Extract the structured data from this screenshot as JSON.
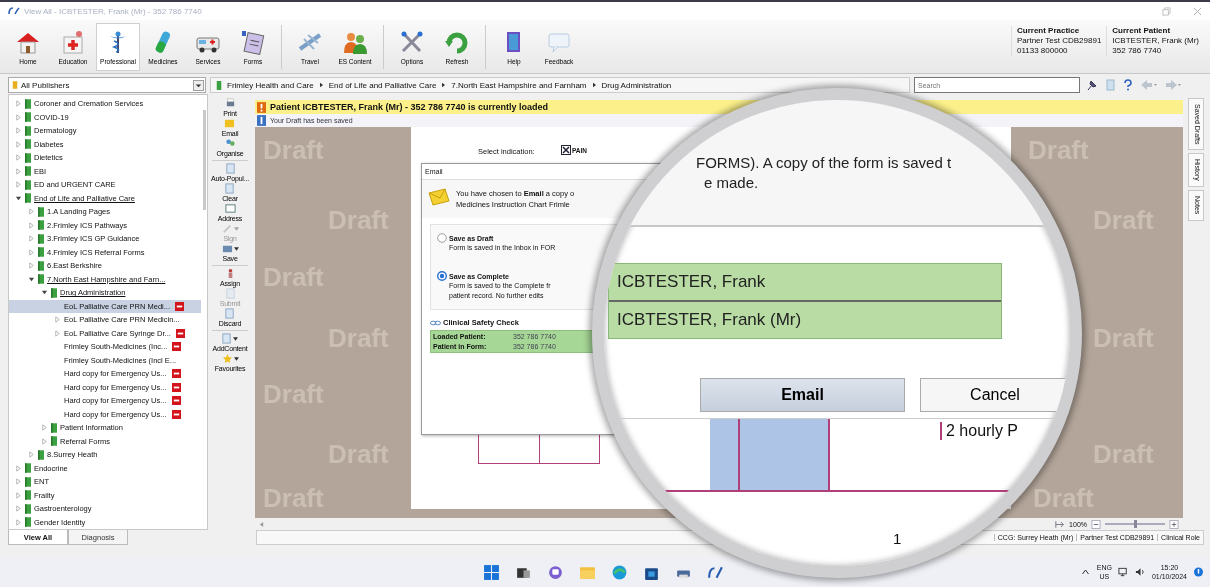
{
  "window": {
    "title": "View All - ICBTESTER, Frank (Mr) - 352 786 7740"
  },
  "toolbar": [
    [
      {
        "label": "Home",
        "kind": "home",
        "selected": false
      },
      {
        "label": "Education",
        "kind": "education",
        "selected": false
      },
      {
        "label": "Professional",
        "kind": "professional",
        "selected": true
      },
      {
        "label": "Medicines",
        "kind": "medicines",
        "selected": false
      },
      {
        "label": "Services",
        "kind": "services",
        "selected": false
      },
      {
        "label": "Forms",
        "kind": "forms",
        "selected": false
      }
    ],
    [
      {
        "label": "Travel",
        "kind": "travel",
        "selected": false
      },
      {
        "label": "ES Content",
        "kind": "content",
        "selected": false
      }
    ],
    [
      {
        "label": "Options",
        "kind": "options",
        "selected": false
      },
      {
        "label": "Refresh",
        "kind": "refresh",
        "selected": false
      }
    ],
    [
      {
        "label": "Help",
        "kind": "help",
        "selected": false
      },
      {
        "label": "Feedback",
        "kind": "feedback",
        "selected": false
      }
    ]
  ],
  "practice": {
    "heading": "Current Practice",
    "name": "Partner Test CDB29891",
    "phone": "01133 800000"
  },
  "patient": {
    "heading": "Current Patient",
    "name": "ICBTESTER, Frank (Mr)",
    "number": "352 786 7740"
  },
  "publisher_select": {
    "value": "All Publishers"
  },
  "breadcrumb": [
    "Frimley Health and Care",
    "End of Life and Palliative Care",
    "7.North East Hampshire and Farnham",
    "Drug Administration"
  ],
  "search": {
    "placeholder": "Search"
  },
  "tree": [
    {
      "label": "Coroner and Cremation Services",
      "expanded": false,
      "selected": false
    },
    {
      "label": "COVID-19",
      "expanded": false,
      "selected": false
    },
    {
      "label": "Dermatology",
      "expanded": false,
      "selected": false
    },
    {
      "label": "Diabetes",
      "expanded": false,
      "selected": false
    },
    {
      "label": "Dietetics",
      "expanded": false,
      "selected": false
    },
    {
      "label": "EBI",
      "expanded": false,
      "selected": false
    },
    {
      "label": "ED and URGENT CARE",
      "expanded": false,
      "selected": false
    },
    {
      "label": "End of Life and Palliative Care",
      "expanded": true,
      "selected": false,
      "children": [
        {
          "label": "1.A Landing Pages",
          "expanded": false,
          "selected": false
        },
        {
          "label": "2.Frimley ICS Pathways",
          "expanded": false,
          "selected": false
        },
        {
          "label": "3.Frimley ICS GP Guidance",
          "expanded": false,
          "selected": false
        },
        {
          "label": "4.Frimley ICS Referral Forms",
          "expanded": false,
          "selected": false
        },
        {
          "label": "6.East Berkshire",
          "expanded": false,
          "selected": false
        },
        {
          "label": "7.North East Hampshire and Farn...",
          "expanded": true,
          "selected": false,
          "children": [
            {
              "label": "Drug Administration",
              "expanded": true,
              "selected": false,
              "children": [
                {
                  "label": "EoL Palliative Care PRN Medi...",
                  "kind": "form",
                  "flagged": true,
                  "selected": true
                },
                {
                  "label": "EoL Palliative Care PRN Medicin...",
                  "kind": "form",
                  "expanded": false,
                  "flagged": false,
                  "selected": false
                },
                {
                  "label": "EoL Palliative Care Syringe Dr...",
                  "kind": "form",
                  "expanded": false,
                  "flagged": true,
                  "selected": false
                },
                {
                  "label": "Frimley South-Medicines (Inc...",
                  "kind": "form",
                  "flagged": true,
                  "selected": false
                },
                {
                  "label": "Frimley South-Medicines (Incl E...",
                  "kind": "form",
                  "flagged": false,
                  "selected": false
                },
                {
                  "label": "Hard copy for Emergency Us...",
                  "kind": "form",
                  "flagged": true,
                  "selected": false
                },
                {
                  "label": "Hard copy for Emergency Us...",
                  "kind": "form",
                  "flagged": true,
                  "selected": false
                },
                {
                  "label": "Hard copy for Emergency Us...",
                  "kind": "form",
                  "flagged": true,
                  "selected": false
                },
                {
                  "label": "Hard copy for Emergency Us...",
                  "kind": "form",
                  "flagged": true,
                  "selected": false
                }
              ]
            },
            {
              "label": "Patient Information",
              "expanded": false,
              "selected": false
            },
            {
              "label": "Referral Forms",
              "expanded": false,
              "selected": false
            }
          ]
        },
        {
          "label": "8.Surrey Heath",
          "expanded": false,
          "selected": false
        }
      ]
    },
    {
      "label": "Endocrine",
      "expanded": false,
      "selected": false
    },
    {
      "label": "ENT",
      "expanded": false,
      "selected": false
    },
    {
      "label": "Frailty",
      "expanded": false,
      "selected": false
    },
    {
      "label": "Gastroenterology",
      "expanded": false,
      "selected": false
    },
    {
      "label": "Gender Identity",
      "expanded": false,
      "selected": false
    }
  ],
  "tree_tabs": [
    {
      "label": "View All",
      "selected": true
    },
    {
      "label": "Diagnosis",
      "selected": false
    }
  ],
  "side_tools": [
    [
      {
        "label": "Print",
        "kind": "printer",
        "disabled": false,
        "dropdown": false
      },
      {
        "label": "Email",
        "kind": "envelope",
        "disabled": false,
        "dropdown": false
      },
      {
        "label": "Organise",
        "kind": "people",
        "disabled": false,
        "dropdown": false
      }
    ],
    [
      {
        "label": "Auto-Popul...",
        "kind": "page",
        "disabled": false,
        "dropdown": false
      },
      {
        "label": "Clear",
        "kind": "page",
        "disabled": false,
        "dropdown": false
      },
      {
        "label": "Address",
        "kind": "card",
        "disabled": false,
        "dropdown": false
      },
      {
        "label": "Sign",
        "kind": "pen",
        "disabled": true,
        "dropdown": true
      },
      {
        "label": "Save",
        "kind": "folder",
        "disabled": false,
        "dropdown": true
      }
    ],
    [
      {
        "label": "Assign",
        "kind": "person",
        "disabled": false,
        "dropdown": false
      },
      {
        "label": "Submit",
        "kind": "page",
        "disabled": true,
        "dropdown": false
      },
      {
        "label": "Discard",
        "kind": "page",
        "disabled": false,
        "dropdown": false
      }
    ],
    [
      {
        "label": "AddContent",
        "kind": "page",
        "disabled": false,
        "dropdown": true
      },
      {
        "label": "Favourites",
        "kind": "star",
        "disabled": false,
        "dropdown": true
      }
    ]
  ],
  "alert": "Patient ICBTESTER, Frank (Mr) - 352 786 7740 is currently loaded",
  "info": "Your Draft has been saved",
  "watermarks": [
    "Draft",
    "Draft",
    "Draft",
    "Draft",
    "Draft",
    "Draft",
    "Draft",
    "Draft",
    "Draft",
    "Draft",
    "Draft",
    "Draft"
  ],
  "form": {
    "indication_label": "Select indication:",
    "indication": {
      "label": "PAIN",
      "checked": true
    }
  },
  "dialog": {
    "title": "Email",
    "message": "You have chosen to **Email** a copy o",
    "message_2": "Medicines Instruction Chart Frimle",
    "options": [
      {
        "label": "Save as Draft",
        "lines": [
          "Form is saved in the Inbox in FOR"
        ],
        "selected": false
      },
      {
        "label": "Save as Complete",
        "lines": [
          "Form is saved to the Complete fr",
          "patient record. No further edits"
        ],
        "selected": true
      }
    ],
    "safety": {
      "title": "Clinical Safety Check",
      "rows": [
        {
          "label": "Loaded Patient:",
          "value": "352 786 7740"
        },
        {
          "label": "Patient in Form:",
          "value": "352 786 7740"
        }
      ]
    }
  },
  "magnifier": {
    "lines": [
      "FORMS). A copy of the form is saved t",
      "e made."
    ],
    "names": [
      "ICBTESTER, Frank",
      "ICBTESTER, Frank (Mr)"
    ],
    "buttons": [
      "Email",
      "Cancel"
    ],
    "grid_text": "2 hourly P",
    "page_number": "1"
  },
  "right_tabs": [
    "Saved Drafts",
    "History",
    "Notes"
  ],
  "zoom": {
    "reading": "100%",
    "level": 0.5
  },
  "status_bar": [
    "CCG: Surrey Heath (Mr)",
    "Partner Test CDB29891",
    "Clinical Role"
  ],
  "taskbar": {
    "language": "ENG",
    "region": "US",
    "time": "15:20",
    "date": "01/10/2024"
  }
}
